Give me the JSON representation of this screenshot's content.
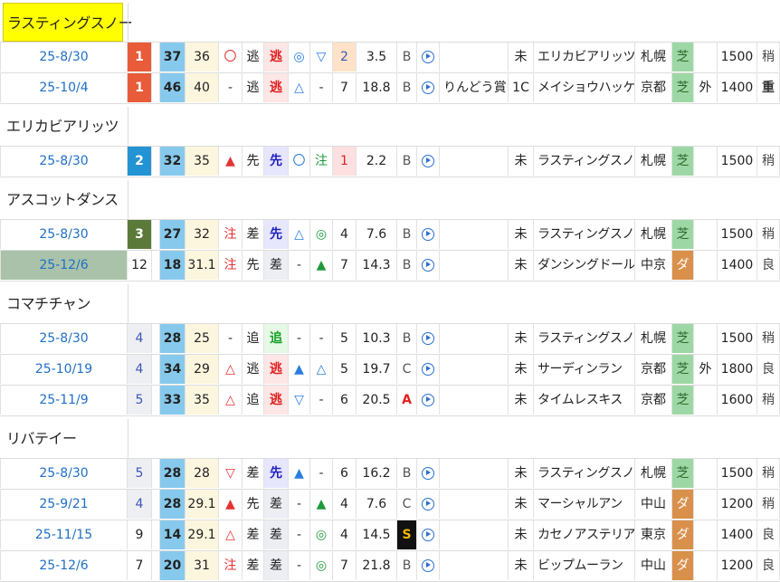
{
  "groups": [
    {
      "name": "ラスティングスノー",
      "highlight": true,
      "rows": [
        {
          "date": "25-8/30",
          "date_hl": false,
          "pos": "1",
          "pos_style": "pos-red",
          "num": "37",
          "val": "36",
          "mark": "〇",
          "mark_style": "mk-red",
          "style": "逃",
          "corner": "逃",
          "corner_style": "st-red",
          "m1": "◎",
          "m1_style": "mk-blue",
          "m2": "▽",
          "m2_style": "mk-blue",
          "rank": "2",
          "rank_style": "r-orange",
          "odds": "3.5",
          "grade": "B",
          "grade_style": "",
          "race": "",
          "cls": "未",
          "opponent": "エリカビアリッツ",
          "venue": "札幌",
          "surface": "芝",
          "surface_style": "surf-turf",
          "course": "",
          "distance": "1500",
          "cond": "稍",
          "cond_style": ""
        },
        {
          "date": "25-10/4",
          "date_hl": false,
          "pos": "1",
          "pos_style": "pos-red",
          "num": "46",
          "val": "40",
          "mark": "-",
          "mark_style": "mk-dark",
          "style": "逃",
          "corner": "逃",
          "corner_style": "st-red",
          "m1": "△",
          "m1_style": "mk-blue",
          "m2": "-",
          "m2_style": "mk-dark",
          "rank": "7",
          "rank_style": "",
          "odds": "18.8",
          "grade": "B",
          "grade_style": "",
          "race": "りんどう賞",
          "cls": "1C",
          "opponent": "メイショウハッケイ",
          "venue": "京都",
          "surface": "芝",
          "surface_style": "surf-turf",
          "course": "外",
          "distance": "1400",
          "cond": "重",
          "cond_style": "cond-bad"
        }
      ]
    },
    {
      "name": "エリカビアリッツ",
      "highlight": false,
      "rows": [
        {
          "date": "25-8/30",
          "date_hl": false,
          "pos": "2",
          "pos_style": "pos-blue",
          "num": "32",
          "val": "35",
          "mark": "▲",
          "mark_style": "mk-red",
          "style": "先",
          "corner": "先",
          "corner_style": "st-blue",
          "m1": "〇",
          "m1_style": "mk-blue",
          "m2": "注",
          "m2_style": "mk-green",
          "rank": "1",
          "rank_style": "r-pink",
          "odds": "2.2",
          "grade": "B",
          "grade_style": "",
          "race": "",
          "cls": "未",
          "opponent": "ラスティングスノー",
          "venue": "札幌",
          "surface": "芝",
          "surface_style": "surf-turf",
          "course": "",
          "distance": "1500",
          "cond": "稍",
          "cond_style": ""
        }
      ]
    },
    {
      "name": "アスコットダンス",
      "highlight": false,
      "rows": [
        {
          "date": "25-8/30",
          "date_hl": false,
          "pos": "3",
          "pos_style": "pos-olive",
          "num": "27",
          "val": "32",
          "mark": "注",
          "mark_style": "mk-red",
          "style": "差",
          "corner": "先",
          "corner_style": "st-blue",
          "m1": "△",
          "m1_style": "mk-blue",
          "m2": "◎",
          "m2_style": "mk-green",
          "rank": "4",
          "rank_style": "",
          "odds": "7.6",
          "grade": "B",
          "grade_style": "",
          "race": "",
          "cls": "未",
          "opponent": "ラスティングスノー",
          "venue": "札幌",
          "surface": "芝",
          "surface_style": "surf-turf",
          "course": "",
          "distance": "1500",
          "cond": "稍",
          "cond_style": ""
        },
        {
          "date": "25-12/6",
          "date_hl": true,
          "pos": "12",
          "pos_style": "",
          "num": "18",
          "val": "31.1",
          "mark": "注",
          "mark_style": "mk-red",
          "style": "先",
          "corner": "差",
          "corner_style": "st-plain",
          "m1": "-",
          "m1_style": "mk-dark",
          "m2": "▲",
          "m2_style": "mk-green",
          "rank": "7",
          "rank_style": "",
          "odds": "14.3",
          "grade": "B",
          "grade_style": "",
          "race": "",
          "cls": "未",
          "opponent": "ダンシングドール",
          "venue": "中京",
          "surface": "ダ",
          "surface_style": "surf-dirt",
          "course": "",
          "distance": "1400",
          "cond": "良",
          "cond_style": ""
        }
      ]
    },
    {
      "name": "コマチチャン",
      "highlight": false,
      "rows": [
        {
          "date": "25-8/30",
          "date_hl": false,
          "pos": "4",
          "pos_style": "pos-gray",
          "num": "28",
          "val": "25",
          "mark": "-",
          "mark_style": "mk-dark",
          "style": "追",
          "corner": "追",
          "corner_style": "st-green",
          "m1": "-",
          "m1_style": "mk-dark",
          "m2": "-",
          "m2_style": "mk-dark",
          "rank": "5",
          "rank_style": "",
          "odds": "10.3",
          "grade": "B",
          "grade_style": "",
          "race": "",
          "cls": "未",
          "opponent": "ラスティングスノー",
          "venue": "札幌",
          "surface": "芝",
          "surface_style": "surf-turf",
          "course": "",
          "distance": "1500",
          "cond": "稍",
          "cond_style": ""
        },
        {
          "date": "25-10/19",
          "date_hl": false,
          "pos": "4",
          "pos_style": "pos-gray",
          "num": "34",
          "val": "29",
          "mark": "△",
          "mark_style": "mk-red",
          "style": "逃",
          "corner": "逃",
          "corner_style": "st-red",
          "m1": "▲",
          "m1_style": "mk-blue",
          "m2": "△",
          "m2_style": "mk-blue",
          "rank": "5",
          "rank_style": "",
          "odds": "19.7",
          "grade": "C",
          "grade_style": "",
          "race": "",
          "cls": "未",
          "opponent": "サーディンラン",
          "venue": "京都",
          "surface": "芝",
          "surface_style": "surf-turf",
          "course": "外",
          "distance": "1800",
          "cond": "良",
          "cond_style": ""
        },
        {
          "date": "25-11/9",
          "date_hl": false,
          "pos": "5",
          "pos_style": "pos-gray",
          "num": "33",
          "val": "35",
          "mark": "△",
          "mark_style": "mk-red",
          "style": "追",
          "corner": "逃",
          "corner_style": "st-red",
          "m1": "▽",
          "m1_style": "mk-blue",
          "m2": "-",
          "m2_style": "mk-dark",
          "rank": "6",
          "rank_style": "",
          "odds": "20.5",
          "grade": "A",
          "grade_style": "grade-A",
          "race": "",
          "cls": "未",
          "opponent": "タイムレスキス",
          "venue": "京都",
          "surface": "芝",
          "surface_style": "surf-turf",
          "course": "",
          "distance": "1600",
          "cond": "稍",
          "cond_style": ""
        }
      ]
    },
    {
      "name": "リバテイー",
      "highlight": false,
      "rows": [
        {
          "date": "25-8/30",
          "date_hl": false,
          "pos": "5",
          "pos_style": "pos-gray",
          "num": "28",
          "val": "28",
          "mark": "▽",
          "mark_style": "mk-red",
          "style": "差",
          "corner": "先",
          "corner_style": "st-blue",
          "m1": "▲",
          "m1_style": "mk-blue",
          "m2": "-",
          "m2_style": "mk-dark",
          "rank": "6",
          "rank_style": "",
          "odds": "16.2",
          "grade": "B",
          "grade_style": "",
          "race": "",
          "cls": "未",
          "opponent": "ラスティングスノー",
          "venue": "札幌",
          "surface": "芝",
          "surface_style": "surf-turf",
          "course": "",
          "distance": "1500",
          "cond": "稍",
          "cond_style": ""
        },
        {
          "date": "25-9/21",
          "date_hl": false,
          "pos": "4",
          "pos_style": "pos-gray",
          "num": "28",
          "val": "29.1",
          "mark": "▲",
          "mark_style": "mk-red",
          "style": "先",
          "corner": "差",
          "corner_style": "st-plain",
          "m1": "-",
          "m1_style": "mk-dark",
          "m2": "▲",
          "m2_style": "mk-green",
          "rank": "4",
          "rank_style": "",
          "odds": "7.6",
          "grade": "C",
          "grade_style": "",
          "race": "",
          "cls": "未",
          "opponent": "マーシャルアン",
          "venue": "中山",
          "surface": "ダ",
          "surface_style": "surf-dirt",
          "course": "",
          "distance": "1200",
          "cond": "稍",
          "cond_style": ""
        },
        {
          "date": "25-11/15",
          "date_hl": false,
          "pos": "9",
          "pos_style": "",
          "num": "14",
          "val": "29.1",
          "mark": "△",
          "mark_style": "mk-red",
          "style": "差",
          "corner": "差",
          "corner_style": "st-plain",
          "m1": "-",
          "m1_style": "mk-dark",
          "m2": "◎",
          "m2_style": "mk-green",
          "rank": "4",
          "rank_style": "",
          "odds": "14.5",
          "grade": "S",
          "grade_style": "grade-S",
          "race": "",
          "cls": "未",
          "opponent": "カセノアステリア",
          "venue": "東京",
          "surface": "ダ",
          "surface_style": "surf-dirt",
          "course": "",
          "distance": "1400",
          "cond": "良",
          "cond_style": ""
        },
        {
          "date": "25-12/6",
          "date_hl": false,
          "pos": "7",
          "pos_style": "",
          "num": "20",
          "val": "31",
          "mark": "注",
          "mark_style": "mk-red",
          "style": "差",
          "corner": "差",
          "corner_style": "st-plain",
          "m1": "-",
          "m1_style": "mk-dark",
          "m2": "◎",
          "m2_style": "mk-green",
          "rank": "7",
          "rank_style": "",
          "odds": "21.8",
          "grade": "B",
          "grade_style": "",
          "race": "",
          "cls": "未",
          "opponent": "ビップムーラン",
          "venue": "中山",
          "surface": "ダ",
          "surface_style": "surf-dirt",
          "course": "",
          "distance": "1200",
          "cond": "良",
          "cond_style": ""
        }
      ]
    }
  ]
}
